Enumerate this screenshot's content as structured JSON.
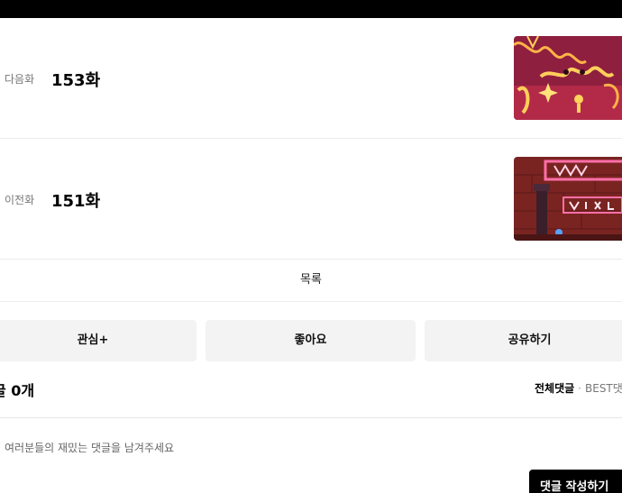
{
  "next_episode": {
    "kind_label": "다음화",
    "title": "153화"
  },
  "prev_episode": {
    "kind_label": "이전화",
    "title": "151화"
  },
  "list_label": "목록",
  "actions": {
    "interest_label": "관심+",
    "like_label": "좋아요",
    "share_label": "공유하기"
  },
  "comments": {
    "count_text": "글 0개",
    "tab_all": "전체댓글",
    "tab_separator": "·",
    "tab_best": "BEST댓",
    "prompt": "여러분들의 재밌는 댓글을 남겨주세요",
    "write_label": "댓글 작성하기"
  },
  "colors": {
    "top_bar": "#000000",
    "button_bg": "#f3f3f3",
    "write_button_bg": "#000000"
  }
}
